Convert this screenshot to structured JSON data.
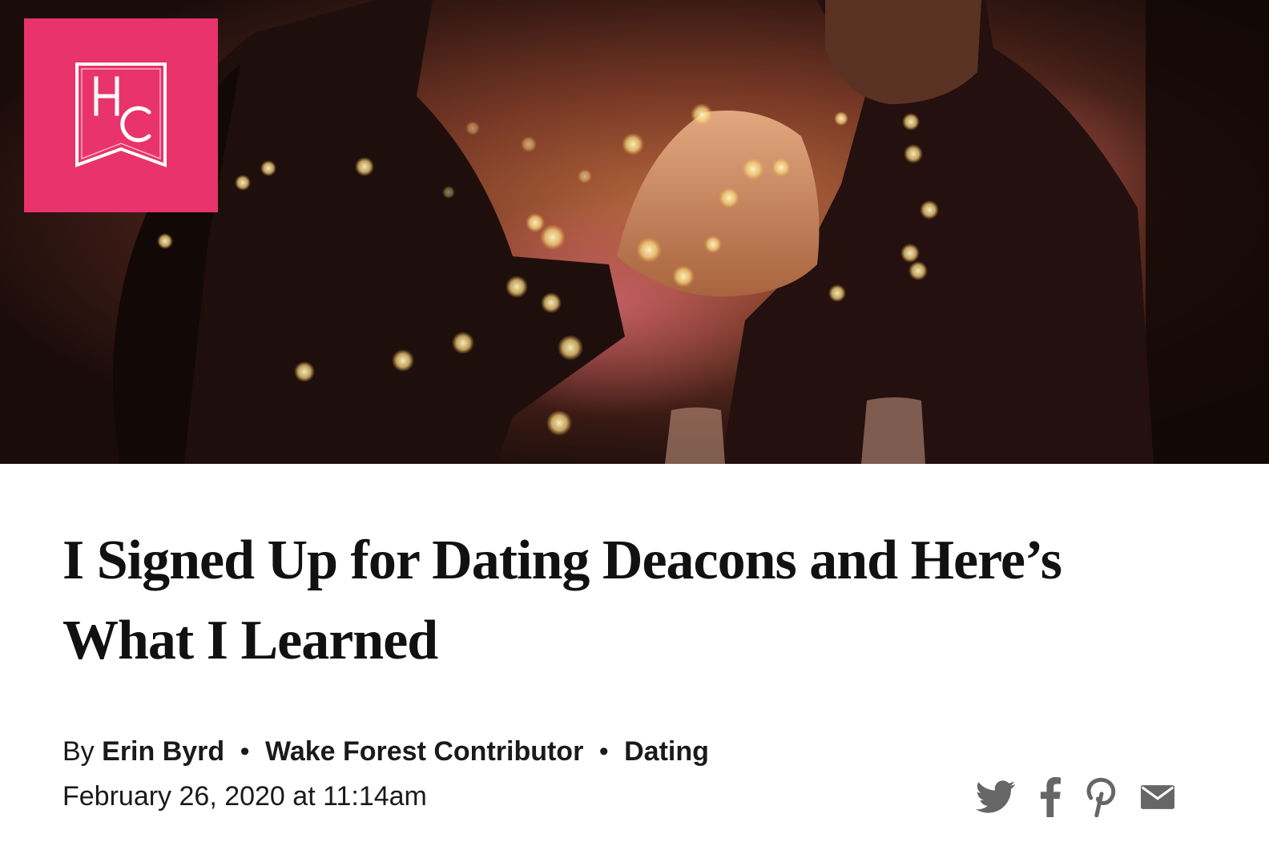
{
  "brand": {
    "logo_letters": "HC",
    "accent_color": "#e8336c"
  },
  "article": {
    "title": "I Signed Up for Dating Deacons and Here’s What I Learned",
    "byline_prefix": "By",
    "author": "Erin Byrd",
    "separator": "•",
    "role": "Wake Forest Contributor",
    "category": "Dating",
    "date": "February 26, 2020 at 11:14am"
  },
  "share": {
    "icons": [
      "twitter-icon",
      "facebook-icon",
      "pinterest-icon",
      "email-icon"
    ],
    "icon_color": "#666666"
  }
}
